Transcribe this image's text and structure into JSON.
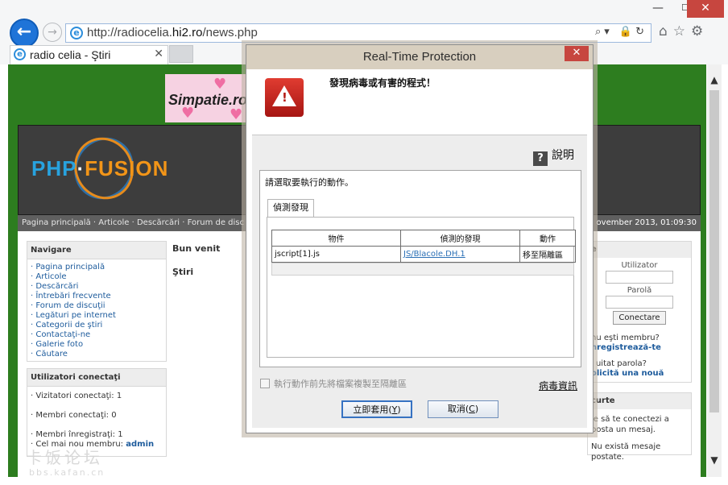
{
  "browser": {
    "url_prefix": "http://radiocelia.",
    "url_host": "hi2.ro",
    "url_suffix": "/news.php",
    "tab_title": "radio celia - Ştiri",
    "win_min": "—",
    "win_max": "☐",
    "win_close": "✕",
    "back": "←",
    "forward": "→",
    "addr_tools": "⌕▾ 🔒↻",
    "toolbar_icons": "⌂☆⚙"
  },
  "site": {
    "banner_text": "Simpatie.ro",
    "logo_php": "PHP",
    "logo_fusion": "FUSION",
    "logo_dot": "·",
    "nav": "Pagina principală · Articole · Descărcări · Forum de disc",
    "date": "ovember 2013, 01:09:30",
    "sidebar_nav_title": "Navigare",
    "sidebar_nav_items": [
      "· Pagina principală",
      "· Articole",
      "· Descărcări",
      "· Întrebări frecvente",
      "· Forum de discuţii",
      "· Legături pe internet",
      "· Categorii de ştiri",
      "· Contactaţi-ne",
      "· Galerie foto",
      "· Căutare"
    ],
    "online_title": "Utilizatori conectaţi",
    "online_guests": "· Vizitatori conectaţi: 1",
    "online_members": "· Membri conectaţi: 0",
    "registered": "· Membri înregistraţi: 1",
    "newest": "· Cel mai nou membru:",
    "newest_name": "admin",
    "welcome": "Bun venit",
    "news": "Ştiri",
    "login_title": "e",
    "user_label": "Utilizator",
    "pass_label": "Parolă",
    "login_btn": "Conectare",
    "not_member": "nu eşti membru?",
    "register": "nregistrează-te",
    "forgot": "i uitat parola?",
    "request": "olicită una nouă",
    "shout_title": "curte",
    "shout_text": "ie să te conectezi a posta un mesaj.",
    "no_msgs": "Nu există mesaje postate.",
    "watermark": "卡饭论坛",
    "watermark_url": "bbs.kafan.cn"
  },
  "dialog": {
    "title": "Real-Time Protection",
    "close": "✕",
    "warning": "發現病毒或有害的程式！",
    "help": "說明",
    "help_icon": "?",
    "prompt": "請選取要執行的動作。",
    "tab": "偵測發現",
    "columns": [
      "物件",
      "偵測的發現",
      "動作"
    ],
    "rows": [
      {
        "object": "jscript[1].js",
        "detection": "JS/Blacole.DH.1",
        "action": "移至隔離區"
      }
    ],
    "checkbox": "執行動作前先將檔案複製至隔離區",
    "virus_info": "病毒資訊",
    "apply": "立即套用(",
    "apply_key": "Y",
    "cancel": "取消(",
    "cancel_key": "C",
    "close_paren": ")"
  },
  "colors": {
    "page_bg": "#2d7d1f",
    "dialog_title_bg": "#d8cfbf",
    "close_red": "#c7463f",
    "warn_red": "#d9312b",
    "link_blue": "#1d5b9c"
  }
}
